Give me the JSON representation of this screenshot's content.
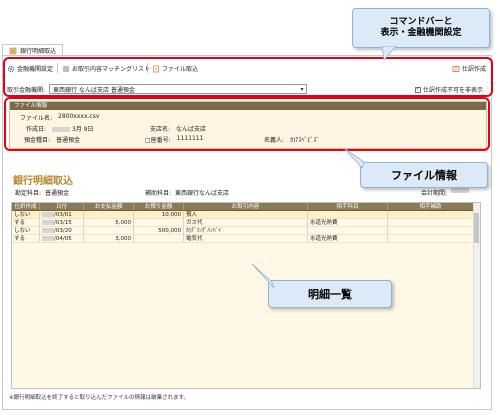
{
  "tab": {
    "label": "銀行明細取込"
  },
  "toolbar": {
    "bank_settings": "金融機関設定",
    "matching_list": "お取引内容マッチングリスト",
    "file_import": "ファイル取込",
    "create_journal": "仕訳作成"
  },
  "account": {
    "label": "取引金融機関:",
    "value": "東西銀行 なんば支店 普通預金",
    "hide_label": "仕訳作成不可を非表示",
    "hide_checked": true
  },
  "file_info": {
    "header": "ファイル情報",
    "filename_label": "ファイル名:",
    "filename_value": "2800xxxx.csv",
    "created_label": "作成日:",
    "created_value": "3月 9日",
    "branch_label": "支店名:",
    "branch_value": "なんば支店",
    "deposit_label": "預金種目:",
    "deposit_value": "普通預金",
    "account_no_label": "□座番号:",
    "account_no_value": "1111111",
    "holder_label": "名義人:",
    "holder_value": "ｶ)ｱｽﾍﾟﾋﾟｽﾞ"
  },
  "detail": {
    "title": "銀行明細取込",
    "account_subject_label": "勘定科目:",
    "account_subject_value": "普通預金",
    "sub_subject_label": "補助科目:",
    "sub_subject_value": "東西銀行なんば支店",
    "period_label": "会計期間:",
    "columns": [
      "仕訳作成",
      "日付",
      "お支払金額",
      "お預り金額",
      "お取引内容",
      "相手科目",
      "相手補助"
    ],
    "rows": [
      {
        "create": "しない",
        "date": "/03/01",
        "pay": "",
        "deposit": "10,000",
        "desc": "預入",
        "subject": "",
        "sub": ""
      },
      {
        "create": "する",
        "date": "/03/15",
        "pay": "5,000",
        "deposit": "",
        "desc": "ガス代",
        "subject": "水道光熱費",
        "sub": ""
      },
      {
        "create": "しない",
        "date": "/03/20",
        "pay": "",
        "deposit": "500,000",
        "desc": "ｶ)ｸﾞﾘﾝｸﾞﾊﾝﾊﾞｲ",
        "subject": "",
        "sub": ""
      },
      {
        "create": "する",
        "date": "/04/05",
        "pay": "3,000",
        "deposit": "",
        "desc": "電気代",
        "subject": "水道光熱費",
        "sub": ""
      }
    ],
    "footer_note": "※銀行明細取込を終了すると取り込んだファイルの情報は破棄されます。"
  },
  "callouts": {
    "command": [
      "コマンドバーと",
      "表示・金融機関設定"
    ],
    "fileinfo": "ファイル情報",
    "list": "明細一覧"
  },
  "colors": {
    "highlight": "#e60012",
    "callout_bg": "#dce9f7",
    "title": "#b8862b"
  }
}
